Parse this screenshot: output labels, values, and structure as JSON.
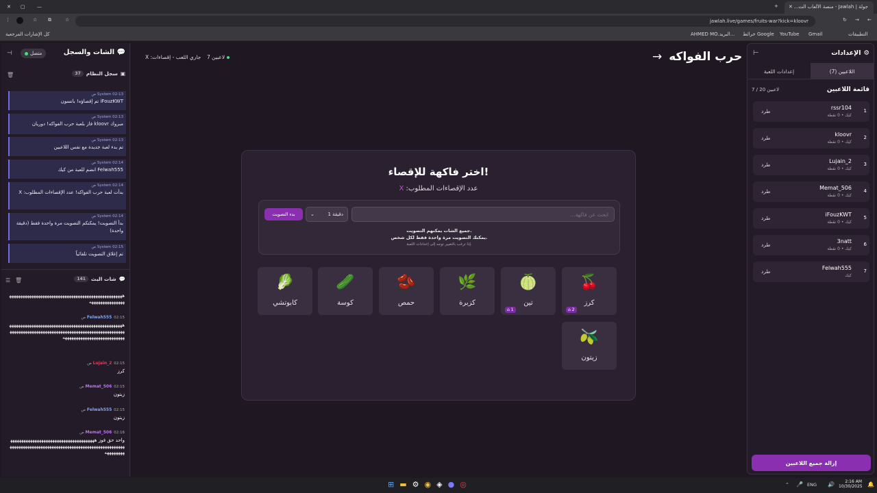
{
  "browser": {
    "tab_title": "جولة | Jawlah - منصة الألعاب الت...",
    "url": "jawlah.live/games/fruits-war?kick=kloovr",
    "bookmarks_left": "كل الإشارات المرجعية",
    "bookmarks": [
      "التطبيقات",
      "Gmail",
      "YouTube",
      "خرائط Google",
      "البريد...",
      "AHMED MO..."
    ]
  },
  "header": {
    "title": "حرب الفواكه",
    "players_count": "7 لاعبين",
    "status": "جاري اللعب - إقصاءات: X"
  },
  "left": {
    "chat_title": "الشات والسجل",
    "online": "متصل",
    "system_log_title": "سجل النظام",
    "system_log_count": "37",
    "system_msgs": [
      {
        "time": "02:13 ص",
        "who": "System",
        "text": "iFouzKWT تم إقصاؤه! بانسون"
      },
      {
        "time": "02:13 ص",
        "who": "System",
        "text": "مبروك kloovr فاز بلعبة حرب الفواكه! دوريان"
      },
      {
        "time": "02:13 ص",
        "who": "System",
        "text": "تم بدء لعبة جديدة مع نفس اللاعبين"
      },
      {
        "time": "02:14 ص",
        "who": "System",
        "text": "Felwah555 انضم للعبة من كيك"
      },
      {
        "time": "02:14 ص",
        "who": "System",
        "text": "بدأت لعبة حرب الفواكه! عدد الإقصاءات المطلوب: X"
      },
      {
        "time": "02:14 ص",
        "who": "System",
        "text": "بدأ التصويت! يمكنكم التصويت مرة واحدة فقط (دقيقة واحدة)"
      },
      {
        "time": "02:15 ص",
        "who": "System",
        "text": "تم إغلاق التصويت تلقائياً"
      }
    ],
    "stream_chat_title": "شات البث",
    "stream_chat_count": "141",
    "chat_msgs": [
      {
        "who": "",
        "time": "",
        "text": "هههههههههههههههههههههههههههههههههههههههههههههههههههههههههههههههههههه"
      },
      {
        "who": "Felwah555",
        "time": "02:15 ص",
        "text": "هههههههههههههههههههههههههههههههههههههههههههههههههههههههههههههههههههههههههههههههههههههههههههههههههههههههههههههههههههههههههههههههههههه"
      },
      {
        "who": "Lujain_2",
        "time": "02:15 ص",
        "text": "كرز"
      },
      {
        "who": "Memat_506",
        "time": "02:15 ص",
        "text": "زيتون"
      },
      {
        "who": "Felwah555",
        "time": "02:15 ص",
        "text": "زيتون"
      },
      {
        "who": "Memat_506",
        "time": "02:16 ص",
        "text": "واحد حق فوز هههههههههههههههههههههههههههههههههههههههههههههههههههههههههههههههههههههههههههههههههههههههههههههههههههه"
      }
    ]
  },
  "main": {
    "vote_title": "اختر فاكهة للإقصاء!",
    "required_label": "عدد الإقصاءات المطلوب:",
    "required_value": "X",
    "search_placeholder": "ابحث عن فاكهة...",
    "duration": "1 دقيقة",
    "start_vote": "بدء التصويت",
    "hint1": "جميع الشات يمكنهم التصويت.",
    "hint2": "يمكنك التصويت مرة واحدة فقط لكل شخص.",
    "hint3": "إذا ترغب بالتغيير توجه إلى إعدادات اللعبة.",
    "fruits": [
      {
        "name": "كرز",
        "emoji": "🍒",
        "votes": "2"
      },
      {
        "name": "تين",
        "emoji": "🍈",
        "votes": "1"
      },
      {
        "name": "كزبرة",
        "emoji": "🌿",
        "votes": ""
      },
      {
        "name": "حمص",
        "emoji": "🫘",
        "votes": ""
      },
      {
        "name": "كوسة",
        "emoji": "🥒",
        "votes": ""
      },
      {
        "name": "كابوتشي",
        "emoji": "🥬",
        "votes": ""
      },
      {
        "name": "زيتون",
        "emoji": "🫒",
        "votes": ""
      }
    ]
  },
  "right": {
    "settings_title": "الإعدادات",
    "tab_players": "اللاعبين (7)",
    "tab_game": "إعدادات اللعبة",
    "list_title": "قائمة اللاعبين",
    "list_count": "7 / 20 لاعبين",
    "kick_label": "طرد",
    "players": [
      {
        "n": "1",
        "name": "rssr104",
        "sub": "كيك • 0 نقطة"
      },
      {
        "n": "2",
        "name": "kloovr",
        "sub": "كيك • 0 نقطة"
      },
      {
        "n": "3",
        "name": "Lujain_2",
        "sub": "كيك • 0 نقطة"
      },
      {
        "n": "4",
        "name": "Memat_506",
        "sub": "كيك • 0 نقطة"
      },
      {
        "n": "5",
        "name": "iFouzKWT",
        "sub": "كيك • 0 نقطة"
      },
      {
        "n": "6",
        "name": "3natt",
        "sub": "كيك • 0 نقطة"
      },
      {
        "n": "7",
        "name": "Felwah555",
        "sub": "كيك"
      }
    ],
    "remove_all": "إزالة جميع اللاعبين"
  },
  "taskbar": {
    "lang": "ENG",
    "time": "2:16 AM",
    "date": "10/30/2025"
  }
}
